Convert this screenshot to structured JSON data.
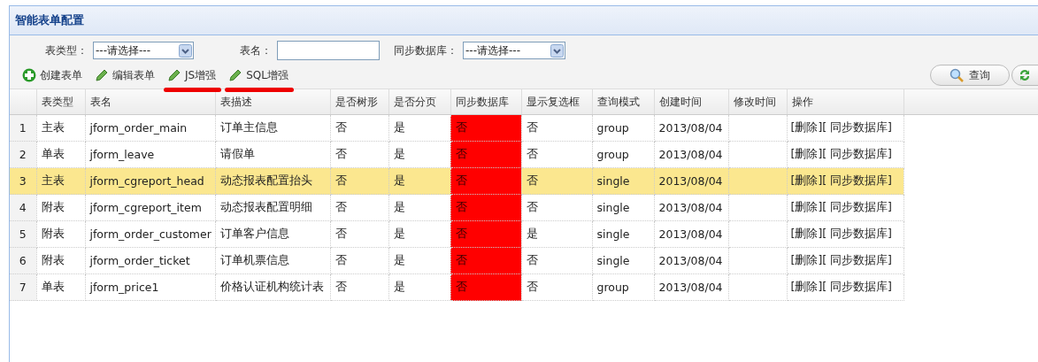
{
  "panel": {
    "title": "智能表单配置"
  },
  "filters": [
    {
      "kind": "select",
      "label": "表类型：",
      "value": "---请选择---"
    },
    {
      "kind": "text",
      "label": "表名："
    },
    {
      "kind": "select",
      "label": "同步数据库：",
      "value": "---请选择---"
    }
  ],
  "toolbar": [
    {
      "kind": "add",
      "label": "创建表单",
      "marked": false
    },
    {
      "kind": "edit",
      "label": "编辑表单",
      "marked": false
    },
    {
      "kind": "edit",
      "label": "JS增强",
      "marked": true
    },
    {
      "kind": "edit",
      "label": "SQL增强",
      "marked": true
    }
  ],
  "search_buttons": [
    {
      "kind": "search",
      "label": "查询"
    },
    {
      "kind": "refresh"
    }
  ],
  "table": {
    "columns": [
      "表类型",
      "表名",
      "表描述",
      "是否树形",
      "是否分页",
      "同步数据库",
      "显示复选框",
      "查询模式",
      "创建时间",
      "修改时间",
      "操作"
    ],
    "rows": [
      {
        "index": "1",
        "selected": false,
        "cells": [
          "主表",
          "jform_order_main",
          "订单主信息",
          "否",
          "是",
          "否",
          "否",
          "group",
          "2013/08/04",
          ""
        ],
        "actions": [
          "[删除]",
          "[ 同步数据库]"
        ]
      },
      {
        "index": "2",
        "selected": false,
        "cells": [
          "单表",
          "jform_leave",
          "请假单",
          "否",
          "是",
          "否",
          "否",
          "group",
          "2013/08/04",
          ""
        ],
        "actions": [
          "[删除]",
          "[ 同步数据库]"
        ]
      },
      {
        "index": "3",
        "selected": true,
        "cells": [
          "主表",
          "jform_cgreport_head",
          "动态报表配置抬头",
          "否",
          "是",
          "否",
          "否",
          "single",
          "2013/08/04",
          ""
        ],
        "actions": [
          "[删除]",
          "[ 同步数据库]"
        ]
      },
      {
        "index": "4",
        "selected": false,
        "cells": [
          "附表",
          "jform_cgreport_item",
          "动态报表配置明细",
          "否",
          "是",
          "否",
          "否",
          "single",
          "2013/08/04",
          ""
        ],
        "actions": [
          "[删除]",
          "[ 同步数据库]"
        ]
      },
      {
        "index": "5",
        "selected": false,
        "cells": [
          "附表",
          "jform_order_customer",
          "订单客户信息",
          "否",
          "是",
          "否",
          "是",
          "single",
          "2013/08/04",
          ""
        ],
        "actions": [
          "[删除]",
          "[ 同步数据库]"
        ]
      },
      {
        "index": "6",
        "selected": false,
        "cells": [
          "附表",
          "jform_order_ticket",
          "订单机票信息",
          "否",
          "是",
          "否",
          "否",
          "single",
          "2013/08/04",
          ""
        ],
        "actions": [
          "[删除]",
          "[ 同步数据库]"
        ]
      },
      {
        "index": "7",
        "selected": false,
        "cells": [
          "单表",
          "jform_price1",
          "价格认证机构统计表",
          "否",
          "是",
          "否",
          "否",
          "group",
          "2013/08/04",
          ""
        ],
        "actions": [
          "[删除]",
          "[ 同步数据库]"
        ]
      }
    ]
  }
}
